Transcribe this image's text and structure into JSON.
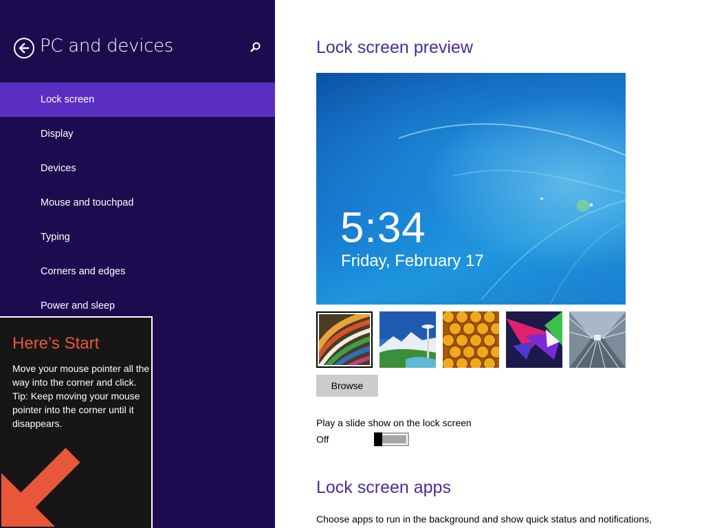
{
  "left_pane": {
    "title": "PC and devices",
    "back_icon": "back-arrow-icon",
    "search_icon": "search-icon",
    "nav_items": [
      {
        "label": "Lock screen",
        "selected": true
      },
      {
        "label": "Display",
        "selected": false
      },
      {
        "label": "Devices",
        "selected": false
      },
      {
        "label": "Mouse and touchpad",
        "selected": false
      },
      {
        "label": "Typing",
        "selected": false
      },
      {
        "label": "Corners and edges",
        "selected": false
      },
      {
        "label": "Power and sleep",
        "selected": false
      }
    ]
  },
  "start_tip": {
    "title": "Here’s Start",
    "body_line1": "Move your mouse pointer all the way into the corner and click.",
    "body_line2": "Tip: Keep moving your mouse pointer into the corner until it disappears.",
    "arrow_icon": "arrow-down-left-icon"
  },
  "content": {
    "preview_title": "Lock screen preview",
    "preview_time": "5:34",
    "preview_date": "Friday, February 17",
    "thumbnails": [
      {
        "name": "ribbons",
        "selected": true
      },
      {
        "name": "space-needle",
        "selected": false
      },
      {
        "name": "honeycomb",
        "selected": false
      },
      {
        "name": "abstract-shapes",
        "selected": false
      },
      {
        "name": "train-station",
        "selected": false
      }
    ],
    "browse_label": "Browse",
    "slideshow_label": "Play a slide show on the lock screen",
    "slideshow_state": "Off",
    "slideshow_on": false,
    "apps_title": "Lock screen apps",
    "apps_description": "Choose apps to run in the background and show quick status and notifications,"
  },
  "colors": {
    "left_pane_bg": "#1c0c4f",
    "selected_bg": "#5a2ec0",
    "accent_title": "#4d2a9b",
    "tip_title": "#e9573a",
    "tip_arrow": "#e9573a"
  }
}
